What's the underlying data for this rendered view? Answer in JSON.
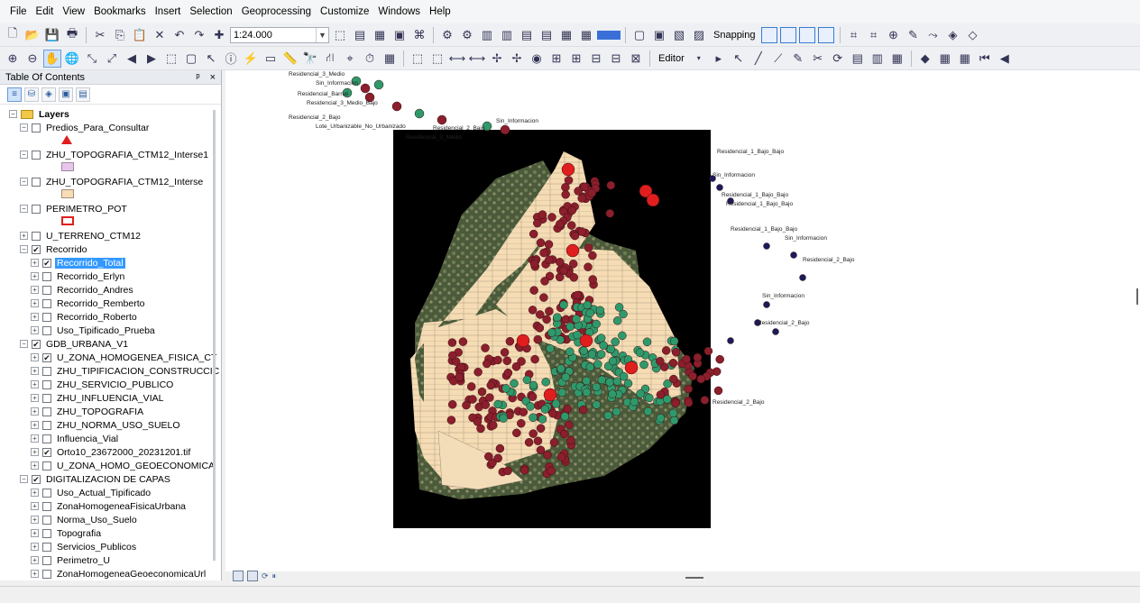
{
  "menu": [
    "File",
    "Edit",
    "View",
    "Bookmarks",
    "Insert",
    "Selection",
    "Geoprocessing",
    "Customize",
    "Windows",
    "Help"
  ],
  "toolbar": {
    "scale_value": "1:24.000",
    "snapping_label": "Snapping",
    "editor_label": "Editor"
  },
  "toc": {
    "title": "Table Of Contents",
    "pin": "ᵖ",
    "close": "×",
    "layers_label": "Layers",
    "items": [
      {
        "label": "Predios_Para_Consultar",
        "level": 1,
        "expand": "-",
        "checked": false
      },
      {
        "label": "ZHU_TOPOGRAFIA_CTM12_Interse1",
        "level": 1,
        "expand": "-",
        "checked": false
      },
      {
        "label": "ZHU_TOPOGRAFIA_CTM12_Interse",
        "level": 1,
        "expand": "-",
        "checked": false
      },
      {
        "label": "PERIMETRO_POT",
        "level": 1,
        "expand": "-",
        "checked": false
      },
      {
        "label": "U_TERRENO_CTM12",
        "level": 1,
        "expand": "+",
        "checked": false
      },
      {
        "label": "Recorrido",
        "level": 1,
        "expand": "-",
        "checked": true
      },
      {
        "label": "Recorrido_Total",
        "level": 2,
        "expand": "+",
        "checked": true,
        "selected": true
      },
      {
        "label": "Recorrido_Erlyn",
        "level": 2,
        "expand": "+",
        "checked": false
      },
      {
        "label": "Recorrido_Andres",
        "level": 2,
        "expand": "+",
        "checked": false
      },
      {
        "label": "Recorrido_Remberto",
        "level": 2,
        "expand": "+",
        "checked": false
      },
      {
        "label": "Recorrido_Roberto",
        "level": 2,
        "expand": "+",
        "checked": false
      },
      {
        "label": "Uso_Tipificado_Prueba",
        "level": 2,
        "expand": "+",
        "checked": false
      },
      {
        "label": "GDB_URBANA_V1",
        "level": 1,
        "expand": "-",
        "checked": true
      },
      {
        "label": "U_ZONA_HOMOGENEA_FISICA_CT",
        "level": 2,
        "expand": "+",
        "checked": true
      },
      {
        "label": "ZHU_TIPIFICACION_CONSTRUCCIC",
        "level": 2,
        "expand": "+",
        "checked": false
      },
      {
        "label": "ZHU_SERVICIO_PUBLICO",
        "level": 2,
        "expand": "+",
        "checked": false
      },
      {
        "label": "ZHU_INFLUENCIA_VIAL",
        "level": 2,
        "expand": "+",
        "checked": false
      },
      {
        "label": "ZHU_TOPOGRAFIA",
        "level": 2,
        "expand": "+",
        "checked": false
      },
      {
        "label": "ZHU_NORMA_USO_SUELO",
        "level": 2,
        "expand": "+",
        "checked": false
      },
      {
        "label": "Influencia_Vial",
        "level": 2,
        "expand": "+",
        "checked": false
      },
      {
        "label": "Orto10_23672000_20231201.tif",
        "level": 2,
        "expand": "+",
        "checked": true
      },
      {
        "label": "U_ZONA_HOMO_GEOECONOMICA",
        "level": 2,
        "expand": "+",
        "checked": false
      },
      {
        "label": "DIGITALIZACION DE CAPAS",
        "level": 1,
        "expand": "-",
        "checked": true
      },
      {
        "label": "Uso_Actual_Tipificado",
        "level": 2,
        "expand": "+",
        "checked": false
      },
      {
        "label": "ZonaHomogeneaFisicaUrbana",
        "level": 2,
        "expand": "+",
        "checked": false
      },
      {
        "label": "Norma_Uso_Suelo",
        "level": 2,
        "expand": "+",
        "checked": false
      },
      {
        "label": "Topografia",
        "level": 2,
        "expand": "+",
        "checked": false
      },
      {
        "label": "Servicios_Publicos",
        "level": 2,
        "expand": "+",
        "checked": false
      },
      {
        "label": "Perimetro_U",
        "level": 2,
        "expand": "+",
        "checked": false
      },
      {
        "label": "ZonaHomogeneaGeoeconomicaUrl",
        "level": 2,
        "expand": "+",
        "checked": false
      }
    ]
  },
  "map": {
    "labels_top": [
      "Residencial_3_Medio",
      "Sin_Informacion",
      "Residencial_Barrial",
      "Residencial_3_Medio_Bajo",
      "Residencial_2_Bajo",
      "Lote_Urbanizable_No_Urbanizado",
      "Residencial_2_Bajo",
      "Residencial_3_Medio",
      "Sin_Informacion"
    ],
    "labels_right": [
      "Residencial_1_Bajo_Bajo",
      "Sin_Informacion",
      "Residencial_1_Bajo_Bajo",
      "Residencial_1_Bajo_Bajo",
      "Residencial_1_Bajo_Bajo",
      "Sin_Informacion",
      "Residencial_2_Bajo",
      "Sin_Informacion",
      "Residencial_2_Bajo",
      "Residencial_2_Bajo"
    ]
  },
  "colors": {
    "maroon": "#8b1f2c",
    "red": "#e01e1e",
    "green": "#2e9a6b",
    "land": "#f5dcb4",
    "black": "#000000"
  }
}
